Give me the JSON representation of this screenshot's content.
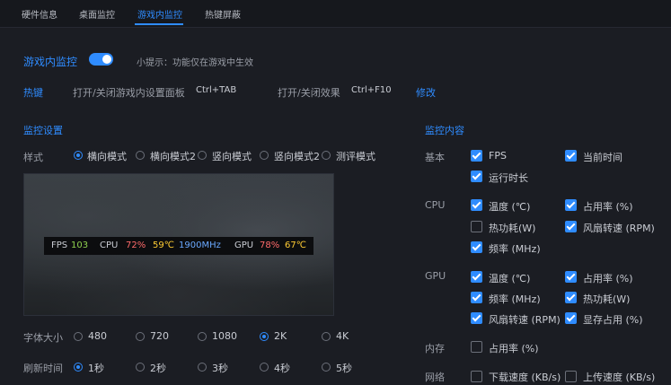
{
  "tabs": [
    "硬件信息",
    "桌面监控",
    "游戏内监控",
    "热键屏蔽"
  ],
  "header": {
    "title": "游戏内监控",
    "hint": "小提示：功能仅在游戏中生效"
  },
  "hotkeys": {
    "label": "热键",
    "panel_label": "打开/关闭游戏内设置面板",
    "panel_key": "Ctrl+TAB",
    "effect_label": "打开/关闭效果",
    "effect_key": "Ctrl+F10",
    "edit": "修改"
  },
  "monitor_settings": {
    "title": "监控设置",
    "style_label": "样式",
    "styles": [
      "横向模式",
      "横向模式2",
      "竖向模式",
      "竖向模式2",
      "测评模式"
    ],
    "font_label": "字体大小",
    "fonts": [
      "480",
      "720",
      "1080",
      "2K",
      "4K"
    ],
    "refresh_label": "刷新时间",
    "refresh": [
      "1秒",
      "2秒",
      "3秒",
      "4秒",
      "5秒"
    ]
  },
  "preview": {
    "fps_label": "FPS",
    "fps": "103",
    "cpu_label": "CPU",
    "cpu_usage": "72%",
    "cpu_temp": "59℃",
    "cpu_freq": "1900MHz",
    "gpu_label": "GPU",
    "gpu_usage": "78%",
    "gpu_temp": "67℃"
  },
  "content": {
    "title": "监控内容",
    "basic_label": "基本",
    "basic": [
      "FPS",
      "当前时间",
      "运行时长"
    ],
    "cpu_label": "CPU",
    "cpu": [
      "温度 (℃)",
      "占用率 (%)",
      "热功耗(W)",
      "风扇转速 (RPM)",
      "频率 (MHz)"
    ],
    "gpu_label": "GPU",
    "gpu": [
      "温度 (℃)",
      "占用率 (%)",
      "频率 (MHz)",
      "热功耗(W)",
      "风扇转速 (RPM)",
      "显存占用 (%)"
    ],
    "mem_label": "内存",
    "mem": [
      "占用率 (%)"
    ],
    "net_label": "网络",
    "net": [
      "下载速度 (KB/s)",
      "上传速度 (KB/s)"
    ]
  },
  "colors": {
    "accent": "#2f8cff",
    "fps": "#8fd14f",
    "usage": "#ff6b6b",
    "temp": "#ffcc33",
    "freq": "#6aa9ff"
  }
}
